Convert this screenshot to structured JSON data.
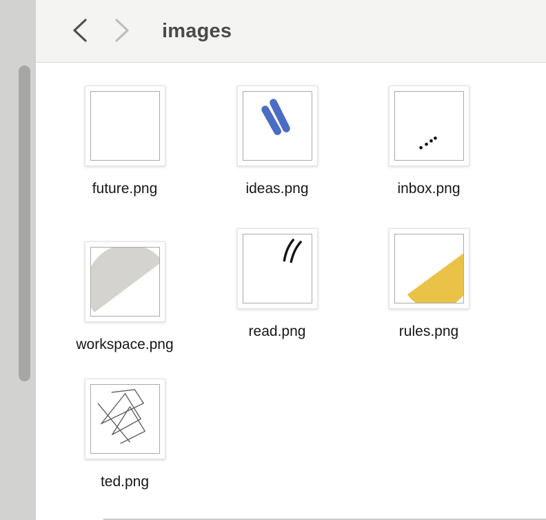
{
  "header": {
    "title": "images",
    "back_icon": "chevron-left",
    "forward_icon": "chevron-right"
  },
  "files": [
    {
      "name": "future.png",
      "art": "blank",
      "art_description": "empty white image"
    },
    {
      "name": "ideas.png",
      "art": "blue-strokes",
      "art_description": "two thick blue diagonal strokes"
    },
    {
      "name": "inbox.png",
      "art": "dots",
      "art_description": "four small black dots ascending diagonally"
    },
    {
      "name": "workspace.png",
      "art": "gray-half-disc",
      "art_description": "gray half disc, dome up-left"
    },
    {
      "name": "read.png",
      "art": "black-slashes",
      "art_description": "two thin black slashes top-right"
    },
    {
      "name": "rules.png",
      "art": "yellow-half-disc",
      "art_description": "yellow half disc, dome down-right"
    },
    {
      "name": "ted.png",
      "art": "scribble",
      "art_description": "thin angular pencil scribble"
    }
  ],
  "colors": {
    "header_bg": "#f4f4f2",
    "strip_bg": "#d2d2d0",
    "scroll_thumb": "#a6a6a4",
    "back_chevron": "#4e4e4e",
    "forward_chevron": "#bcbcba",
    "title_text": "#4a4a48",
    "label_text": "#161616",
    "thumb_inner_border": "#a9a9a9",
    "ideas_blue": "#4a6cc3",
    "rules_yellow": "#e9c247",
    "workspace_gray": "#d5d3cf",
    "scribble_gray": "#5f5f5f",
    "ink": "#151515"
  }
}
